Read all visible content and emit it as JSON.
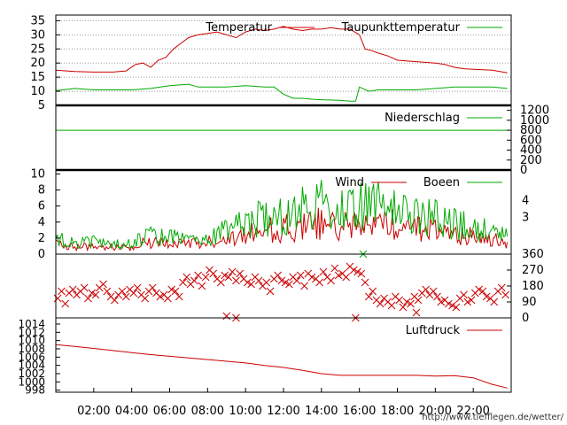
{
  "source_url": "http://www.tiefflegen.de/wetter/",
  "chart_data": [
    {
      "panel": "temperature",
      "type": "line",
      "title": "",
      "ylim": [
        5,
        37
      ],
      "yticks": [
        5,
        10,
        15,
        20,
        25,
        30,
        35
      ],
      "grid": "horizontal-dotted",
      "legend_placement": "top-right",
      "x_unit": "hour",
      "series": [
        {
          "name": "Temperatur",
          "color": "#cc0000",
          "x": [
            0,
            1,
            2,
            3,
            3.7,
            4.2,
            4.6,
            5,
            5.4,
            5.8,
            6.2,
            6.6,
            7,
            7.5,
            8,
            8.5,
            9,
            9.5,
            10,
            10.5,
            11,
            11.5,
            12,
            12.5,
            13,
            13.5,
            14,
            14.5,
            15,
            15.5,
            16,
            16.3,
            16.6,
            17,
            17.5,
            18,
            19,
            20,
            20.5,
            21,
            21.5,
            22,
            23,
            23.8
          ],
          "values": [
            17.5,
            17,
            16.8,
            16.8,
            17.2,
            19.5,
            20,
            18.5,
            21,
            22,
            25,
            27,
            29,
            30,
            30.5,
            31,
            30,
            29,
            31,
            32,
            31.5,
            32,
            33,
            32,
            31.5,
            32,
            32,
            32.5,
            32,
            32,
            30,
            25,
            24.5,
            23.5,
            22.5,
            21,
            20.5,
            20,
            19.5,
            18.5,
            18,
            17.8,
            17.5,
            16.5
          ]
        },
        {
          "name": "Taupunkttemperatur",
          "color": "#00aa00",
          "x": [
            0,
            1,
            2,
            3,
            4,
            5,
            6,
            7,
            7.5,
            8,
            9,
            10,
            11,
            11.5,
            12,
            12.5,
            13,
            13.5,
            14,
            15,
            15.5,
            15.8,
            16,
            16.5,
            17,
            18,
            19,
            20,
            21,
            22,
            23,
            23.8
          ],
          "values": [
            10.2,
            11,
            10.5,
            10.5,
            10.5,
            11,
            12,
            12.5,
            11.5,
            11.5,
            11.5,
            12,
            11.5,
            11.5,
            9,
            7.5,
            7.5,
            7.2,
            7,
            6.8,
            6.5,
            6.5,
            11.5,
            10,
            10.5,
            10.5,
            10.5,
            11,
            11.5,
            11.5,
            11.5,
            11
          ]
        }
      ]
    },
    {
      "panel": "precipitation",
      "type": "line",
      "title": "",
      "ylim": [
        0,
        1300
      ],
      "yticks": [
        0,
        200,
        400,
        600,
        800,
        1000,
        1200
      ],
      "legend_placement": "top-right",
      "series": [
        {
          "name": "Niederschlag",
          "color": "#00aa00",
          "x": [
            0,
            23.8
          ],
          "values": [
            800,
            800
          ]
        }
      ]
    },
    {
      "panel": "wind",
      "type": "line",
      "title": "",
      "ylim": [
        0,
        10.5
      ],
      "yticks": [
        0,
        2,
        4,
        6,
        8,
        10
      ],
      "y2ticks": [
        "3",
        "4"
      ],
      "legend_placement": "top-right",
      "series": [
        {
          "name": "Wind",
          "color": "#cc0000",
          "x": [
            0,
            1,
            2,
            3,
            4,
            5,
            6,
            7,
            8,
            9,
            10,
            11,
            12,
            13,
            14,
            15,
            16,
            17,
            18,
            19,
            20,
            21,
            22,
            23,
            23.8
          ],
          "values": [
            1.2,
            1,
            1,
            0.8,
            1,
            1.5,
            1.5,
            1.2,
            1.5,
            1.8,
            2.5,
            3,
            3.2,
            3.5,
            3.8,
            3.5,
            3.8,
            4,
            3.5,
            3.2,
            3,
            2.5,
            2.2,
            1.8,
            1.5
          ]
        },
        {
          "name": "Boeen",
          "color": "#00aa00",
          "x": [
            0,
            1,
            2,
            3,
            4,
            5,
            6,
            7,
            8,
            9,
            10,
            11,
            12,
            13,
            14,
            15,
            16,
            17,
            18,
            19,
            20,
            21,
            22,
            23,
            23.8
          ],
          "values": [
            1.8,
            1.5,
            1.5,
            1.2,
            1.5,
            2.2,
            2.2,
            1.8,
            2.2,
            2.8,
            3.8,
            4.5,
            5,
            5.5,
            6,
            5.5,
            6,
            6,
            5,
            4.8,
            4.5,
            3.8,
            3.2,
            2.8,
            2.2
          ]
        }
      ]
    },
    {
      "panel": "wind_direction",
      "type": "scatter",
      "title": "",
      "ylim": [
        0,
        360
      ],
      "yticks_right": [
        0,
        90,
        180,
        270,
        360
      ],
      "series": [
        {
          "name": "",
          "color": "#cc0000",
          "marker": "x",
          "x": [
            0.1,
            0.3,
            0.5,
            0.7,
            0.9,
            1.1,
            1.3,
            1.5,
            1.7,
            1.9,
            2.1,
            2.3,
            2.5,
            2.7,
            2.9,
            3.1,
            3.3,
            3.5,
            3.7,
            3.9,
            4.1,
            4.3,
            4.5,
            4.7,
            4.9,
            5.1,
            5.3,
            5.5,
            5.7,
            5.9,
            6.1,
            6.3,
            6.5,
            6.7,
            6.9,
            7.1,
            7.3,
            7.5,
            7.7,
            7.9,
            8.1,
            8.3,
            8.5,
            8.7,
            8.9,
            9.1,
            9.3,
            9.5,
            9.7,
            9.9,
            10.1,
            10.3,
            10.5,
            10.7,
            10.9,
            11.1,
            11.3,
            11.5,
            11.7,
            11.9,
            12.1,
            12.3,
            12.5,
            12.7,
            12.9,
            13.1,
            13.3,
            13.5,
            13.7,
            13.9,
            14.1,
            14.3,
            14.5,
            14.7,
            14.9,
            15.1,
            15.3,
            15.5,
            15.7,
            15.9,
            16.1,
            16.3,
            16.5,
            16.7,
            16.9,
            17.1,
            17.3,
            17.5,
            17.7,
            17.9,
            18.1,
            18.3,
            18.5,
            18.7,
            18.9,
            19.1,
            19.3,
            19.5,
            19.7,
            19.9,
            20.1,
            20.3,
            20.5,
            20.7,
            20.9,
            21.1,
            21.3,
            21.5,
            21.7,
            21.9,
            22.1,
            22.3,
            22.5,
            22.7,
            22.9,
            23.1,
            23.3,
            23.5,
            23.7,
            9.0,
            9.5,
            15.8,
            16.2,
            19.0
          ],
          "values": [
            110,
            150,
            80,
            140,
            160,
            130,
            150,
            170,
            110,
            140,
            130,
            170,
            190,
            150,
            120,
            100,
            130,
            150,
            120,
            160,
            140,
            170,
            130,
            110,
            150,
            170,
            140,
            120,
            130,
            110,
            160,
            150,
            120,
            200,
            230,
            190,
            210,
            240,
            180,
            230,
            270,
            250,
            220,
            200,
            240,
            230,
            260,
            210,
            250,
            220,
            200,
            190,
            230,
            210,
            180,
            200,
            150,
            220,
            240,
            210,
            200,
            190,
            230,
            210,
            240,
            180,
            250,
            230,
            220,
            200,
            260,
            230,
            210,
            280,
            240,
            250,
            230,
            290,
            270,
            260,
            250,
            200,
            120,
            150,
            100,
            80,
            110,
            90,
            70,
            120,
            100,
            60,
            90,
            80,
            120,
            100,
            140,
            160,
            130,
            150,
            120,
            90,
            100,
            80,
            70,
            60,
            110,
            130,
            90,
            100,
            140,
            160,
            150,
            120,
            110,
            90,
            150,
            170,
            130,
            10,
            0,
            0,
            360,
            30
          ]
        }
      ]
    },
    {
      "panel": "pressure",
      "type": "line",
      "title": "",
      "ylim": [
        997.5,
        1015.5
      ],
      "yticks": [
        998,
        1000,
        1002,
        1004,
        1006,
        1008,
        1010,
        1012,
        1014
      ],
      "xlabels": [
        "02:00",
        "04:00",
        "06:00",
        "08:00",
        "10:00",
        "12:00",
        "14:00",
        "16:00",
        "18:00",
        "20:00",
        "22:00"
      ],
      "x_ticks_hours": [
        2,
        4,
        6,
        8,
        10,
        12,
        14,
        16,
        18,
        20,
        22
      ],
      "x_range_hours": [
        0,
        24
      ],
      "legend_placement": "top-right",
      "series": [
        {
          "name": "Luftdruck",
          "color": "#cc0000",
          "x": [
            0,
            1,
            2,
            3,
            4,
            5,
            6,
            7,
            8,
            9,
            10,
            11,
            12,
            13,
            14,
            15,
            16,
            17,
            18,
            19,
            20,
            21,
            22,
            23,
            23.8
          ],
          "values": [
            1009,
            1008.6,
            1008.1,
            1007.6,
            1007.1,
            1006.6,
            1006.2,
            1005.8,
            1005.4,
            1005,
            1004.6,
            1004,
            1003.5,
            1002.8,
            1002,
            1001.6,
            1001.6,
            1001.6,
            1001.6,
            1001.6,
            1001.4,
            1001.5,
            1001.0,
            999.4,
            998.5
          ]
        }
      ]
    }
  ]
}
